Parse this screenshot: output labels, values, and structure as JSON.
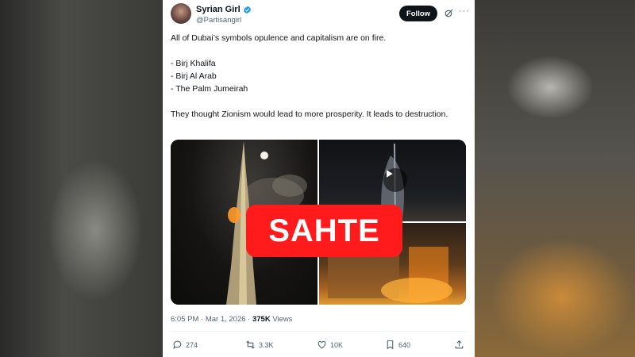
{
  "post": {
    "author_name": "Syrian Girl",
    "handle": "@Partisangirl",
    "follow_label": "Follow",
    "more_label": "···",
    "text_line1": "All of Dubai’s symbols opulence and capitalism are on fire.",
    "list": [
      "- Birj Khalifa",
      "- Birj Al Arab",
      "- The Palm Jumeirah"
    ],
    "text_line2": "They thought Zionism would lead to more prosperity. It leads to destruction.",
    "timestamp": "6:05 PM · Mar 1, 2026 · ",
    "views_count": "375K",
    "views_label": " Views"
  },
  "stamp": {
    "label": "SAHTE",
    "color": "#ff1b1b"
  },
  "actions": {
    "replies": "274",
    "reposts": "3.3K",
    "likes": "10K",
    "bookmarks": "640"
  },
  "icons": [
    "verified-icon",
    "grok-icon",
    "more-icon",
    "play-icon",
    "reply-icon",
    "repost-icon",
    "like-icon",
    "bookmark-icon",
    "share-icon"
  ],
  "colors": {
    "verified": "#1d9bf0",
    "text": "#0f1419",
    "muted": "#536471"
  }
}
